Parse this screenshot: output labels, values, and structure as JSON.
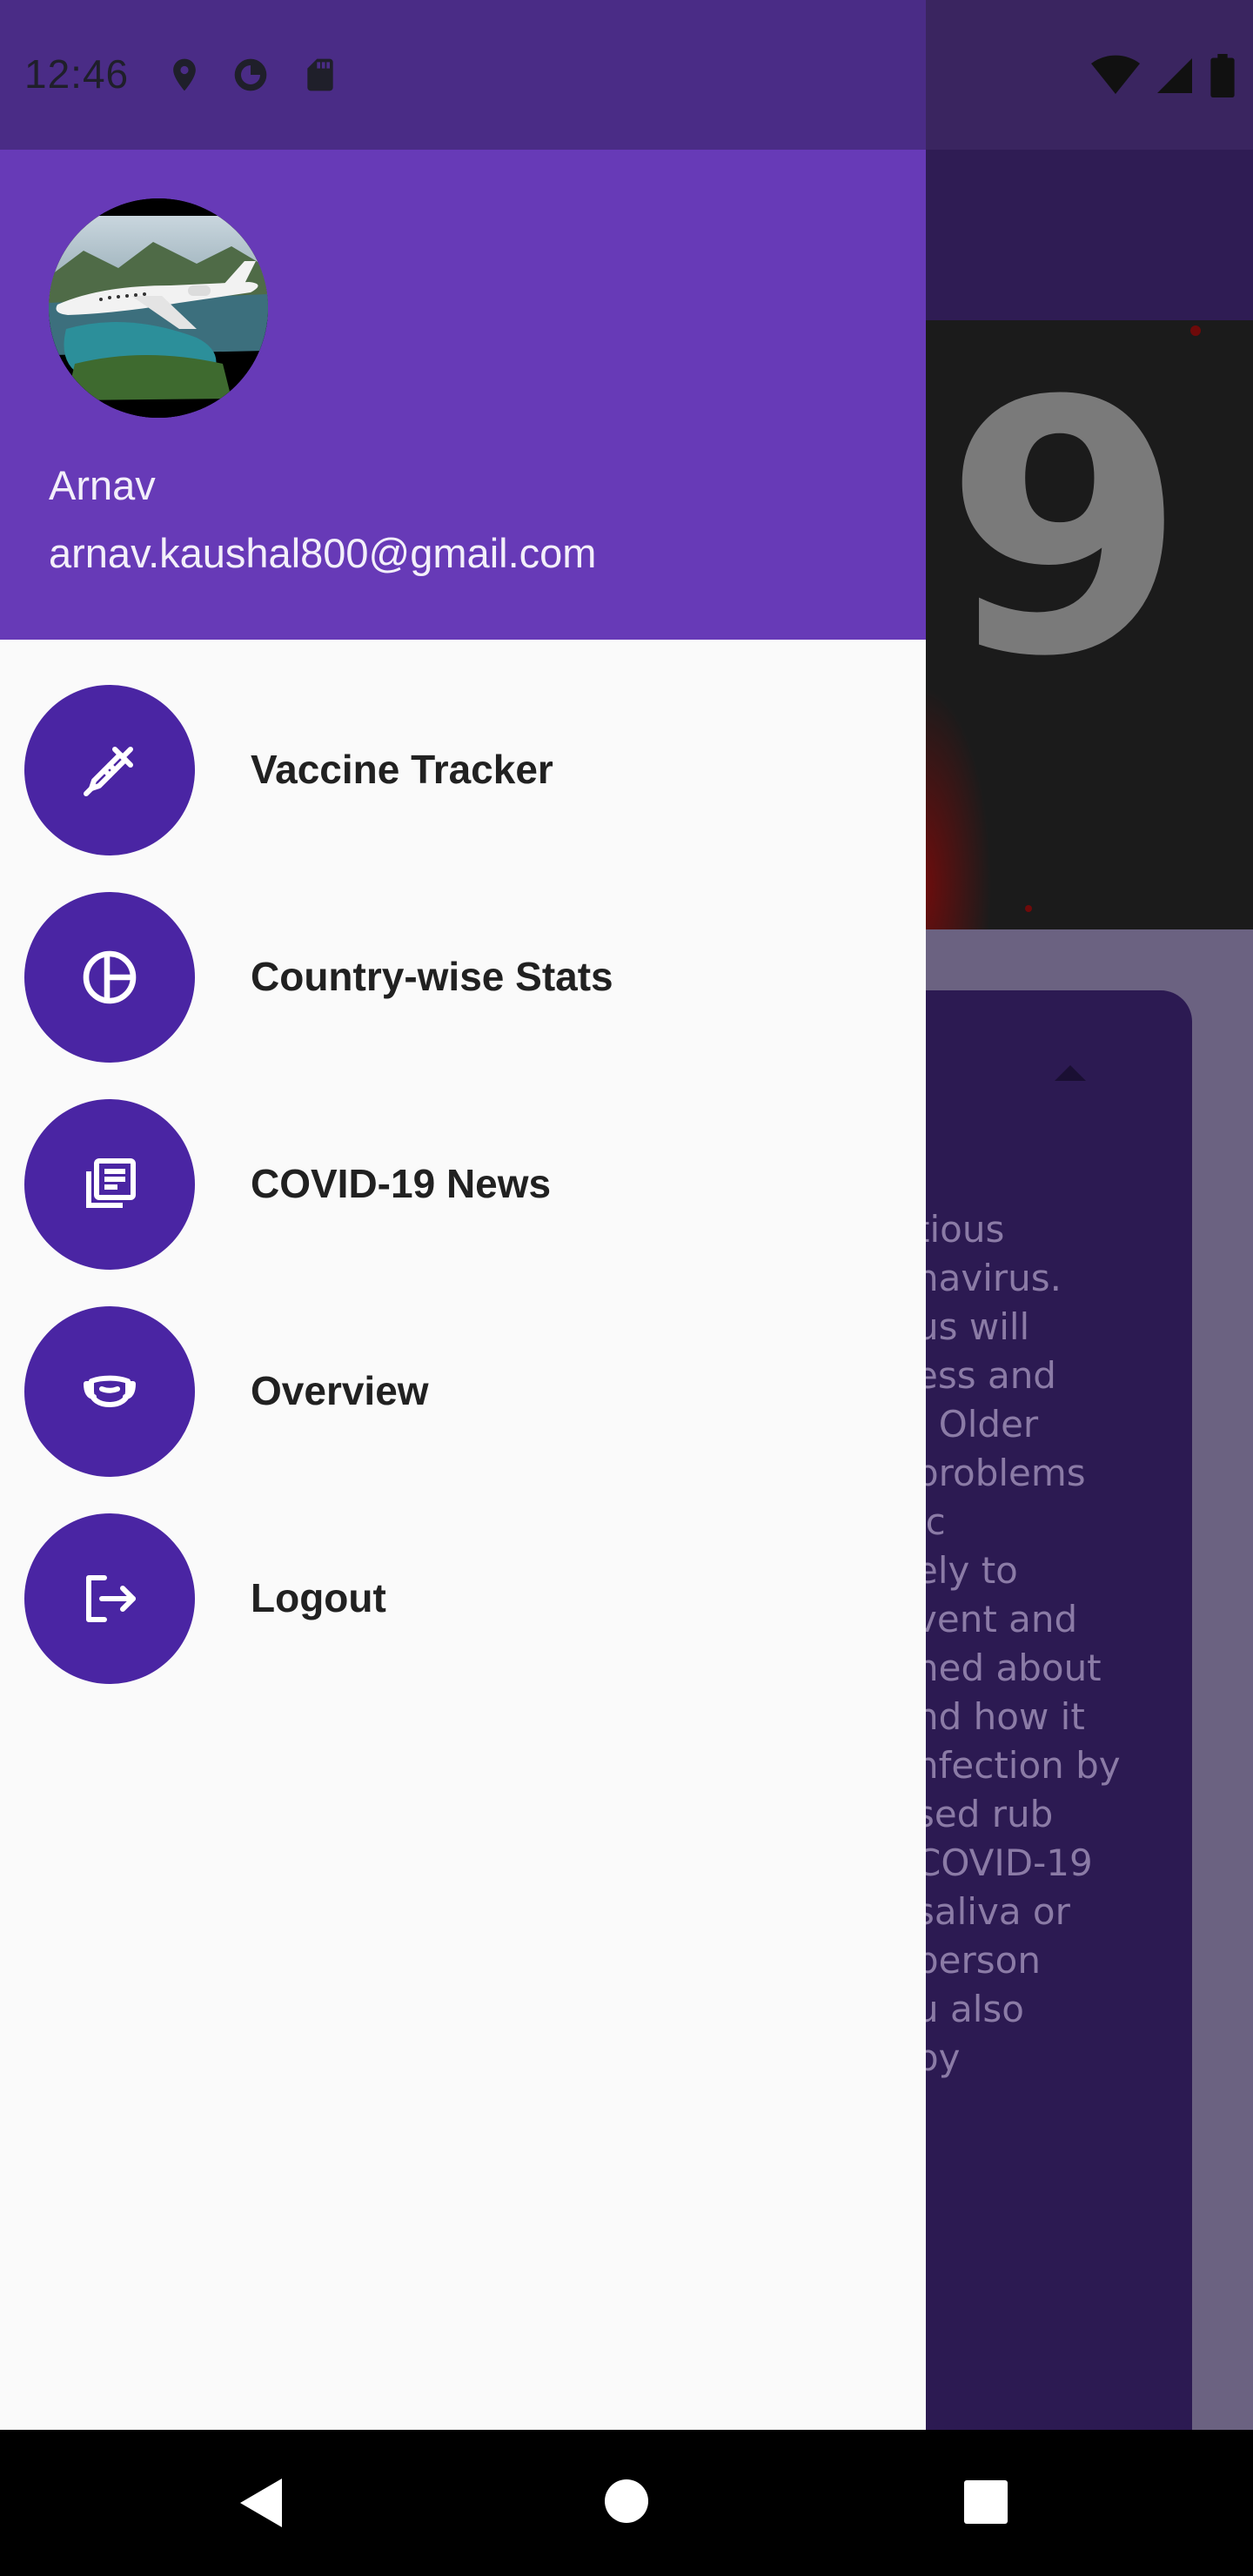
{
  "status_bar": {
    "time": "12:46",
    "left_icons": [
      "location-icon",
      "data-saver-icon",
      "sd-card-icon"
    ],
    "right_icons": [
      "wifi-icon",
      "cell-signal-icon",
      "battery-icon"
    ]
  },
  "drawer": {
    "user": {
      "name": "Arnav",
      "email": "arnav.kaushal800@gmail.com",
      "avatar": "airplane-photo"
    },
    "menu": [
      {
        "label": "Vaccine Tracker",
        "icon": "syringe-icon"
      },
      {
        "label": "Country-wise Stats",
        "icon": "pie-chart-icon"
      },
      {
        "label": "COVID-19 News",
        "icon": "news-icon"
      },
      {
        "label": "Overview",
        "icon": "mask-icon"
      },
      {
        "label": "Logout",
        "icon": "logout-icon"
      }
    ],
    "accent_color": "#673ab7",
    "icon_circle_color": "#4a25a3"
  },
  "background_page": {
    "hero_text": "9",
    "description_fragment": [
      "tious",
      "navirus.",
      "us will",
      "ess and",
      ". Older",
      "problems",
      "ic",
      "ely to",
      "vent and",
      "ned about",
      "nd how it",
      "nfection by",
      "sed rub",
      "COVID-19",
      "saliva or",
      "person",
      "u also",
      "by"
    ]
  },
  "nav_bar": {
    "buttons": [
      "back-icon",
      "home-icon",
      "recents-icon"
    ]
  }
}
